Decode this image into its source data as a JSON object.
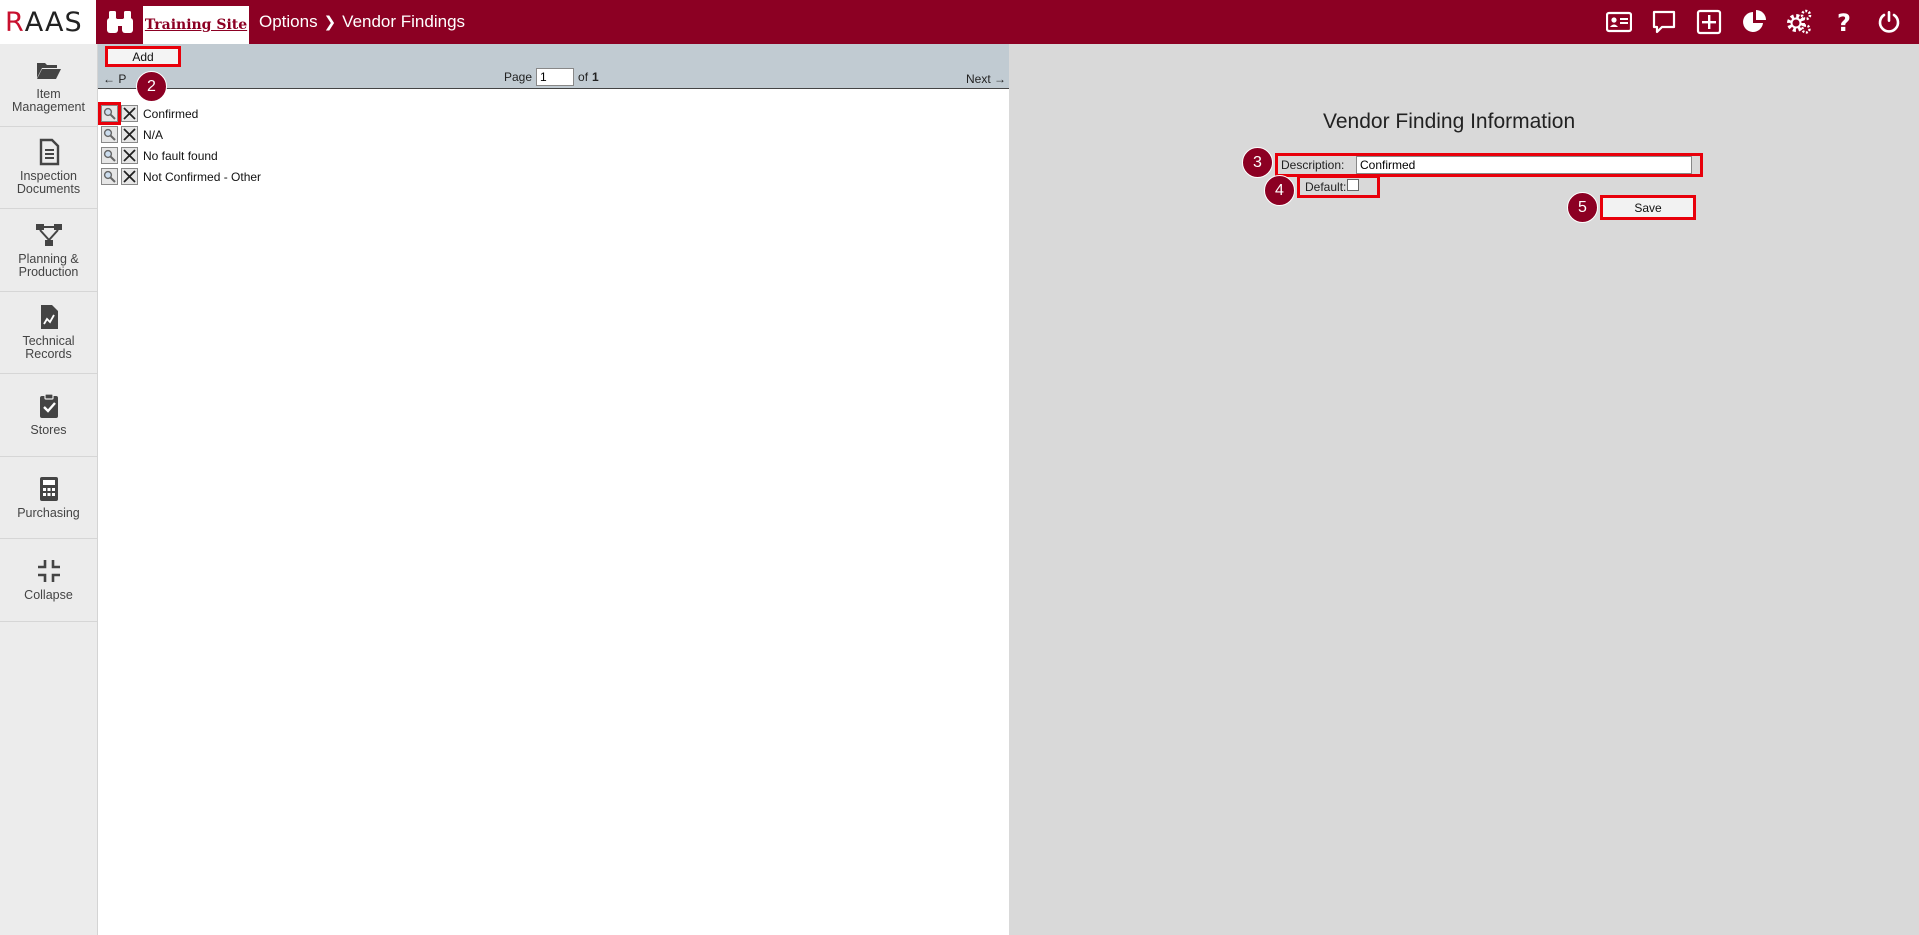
{
  "header": {
    "logo_text": "RAAS",
    "site_tab": "Training Site",
    "breadcrumb": [
      "Options",
      "Vendor Findings"
    ],
    "icons": [
      "id-card-icon",
      "comment-icon",
      "plus-square-icon",
      "pie-chart-icon",
      "settings-icon",
      "help-icon",
      "power-icon"
    ]
  },
  "sidebar": {
    "items": [
      {
        "label": "Item Management",
        "icon": "folder-open-icon"
      },
      {
        "label": "Inspection Documents",
        "icon": "document-icon"
      },
      {
        "label": "Planning & Production",
        "icon": "sitemap-icon"
      },
      {
        "label": "Technical Records",
        "icon": "chart-file-icon"
      },
      {
        "label": "Stores",
        "icon": "clipboard-check-icon"
      },
      {
        "label": "Purchasing",
        "icon": "calculator-icon"
      },
      {
        "label": "Collapse",
        "icon": "compress-icon"
      }
    ]
  },
  "list": {
    "add_label": "Add",
    "prev_label": "← P",
    "page_label": "Page",
    "page_value": "1",
    "of_label": "of",
    "total_pages": "1",
    "next_label": "Next →",
    "rows": [
      {
        "label": "Confirmed"
      },
      {
        "label": "N/A"
      },
      {
        "label": "No fault found"
      },
      {
        "label": "Not Confirmed - Other"
      }
    ]
  },
  "form": {
    "title": "Vendor Finding Information",
    "description_label": "Description:",
    "description_value": "Confirmed",
    "default_label": "Default:",
    "default_checked": false,
    "save_label": "Save"
  },
  "annotations": {
    "step2": "2",
    "step3": "3",
    "step4": "4",
    "step5": "5"
  },
  "colors": {
    "brand": "#8c0023",
    "highlight": "#e8000b",
    "list_header": "#c1cbd2",
    "form_bg": "#d9d9d9"
  }
}
